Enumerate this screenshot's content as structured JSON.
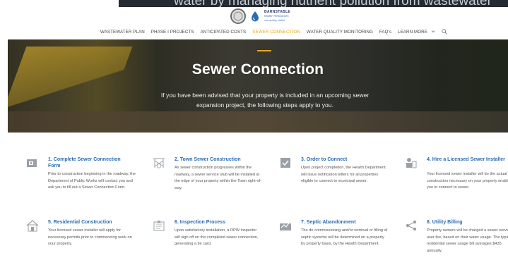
{
  "top_banner": {
    "text": "water by managing nutrient pollution from wastewater"
  },
  "logo": {
    "seal_alt": "town-seal",
    "brand_line1": "BARNSTABLE",
    "brand_line2": "Water Resources",
    "brand_line3": "own quality, skilled"
  },
  "nav": {
    "items": [
      {
        "label": "WASTEWATER PLAN",
        "active": false
      },
      {
        "label": "PHASE I PROJECTS",
        "active": false
      },
      {
        "label": "ANTICIPATED COSTS",
        "active": false
      },
      {
        "label": "SEWER CONNECTION",
        "active": true
      },
      {
        "label": "WATER QUALITY MONITORING",
        "active": false
      },
      {
        "label": "FAQ's",
        "active": false
      },
      {
        "label": "LEARN MORE",
        "active": false
      }
    ],
    "learn_more_chevron": "chevron-down-icon",
    "search_icon": "search-icon",
    "accent_color": "#e8a81c"
  },
  "hero": {
    "title": "Sewer Connection",
    "subtitle": "If you have been advised that your property is included in an upcoming sewer expansion project, the following steps apply to you."
  },
  "steps": [
    {
      "title": "1. Complete Sewer Connection Form",
      "body": "Prior to construction beginning in the roadway, the Department of Public Works will contact you and ask you to fill out a Sewer Connection Form.",
      "icon": "form-icon"
    },
    {
      "title": "2. Town Sewer Construction",
      "body": "As sewer construction progresses within the roadway, a sewer service stub will be installed at the edge of your property within the Town right-of-way.",
      "icon": "construction-icon"
    },
    {
      "title": "3. Order to Connect",
      "body": "Upon project completion, the Health Department will issue notification letters for all properties eligible to connect to municipal sewer.",
      "icon": "order-icon"
    },
    {
      "title": "4. Hire a Licensed Sewer Installer",
      "body": "Your licensed sewer installer will do the actual construction necessary on your property enabling you to connect to sewer.",
      "icon": "installer-icon"
    },
    {
      "title": "5. Residential Construction",
      "body": "Your licensed sewer installer will apply for necessary permits prior to commencing work on your property.",
      "icon": "house-icon"
    },
    {
      "title": "6. Inspection Process",
      "body": "Upon satisfactory installation, a DPW inspector will sign off on the completed sewer connection, generating a tie card.",
      "icon": "inspection-icon"
    },
    {
      "title": "7. Septic Abandonment",
      "body": "The de-commissioning and/or removal or filling of septic systems will be determined on a property by property basis, by the Health Department.",
      "icon": "septic-icon"
    },
    {
      "title": "8. Utility Billing",
      "body": "Property owners will be charged a sewer service user fee, based on their water usage. The typical residential sewer usage bill averages $435 annually.",
      "icon": "billing-icon"
    }
  ],
  "colors": {
    "step_title": "#2b6cb0",
    "icon_gray": "#9aa0a6",
    "hero_text": "#ffffff"
  }
}
